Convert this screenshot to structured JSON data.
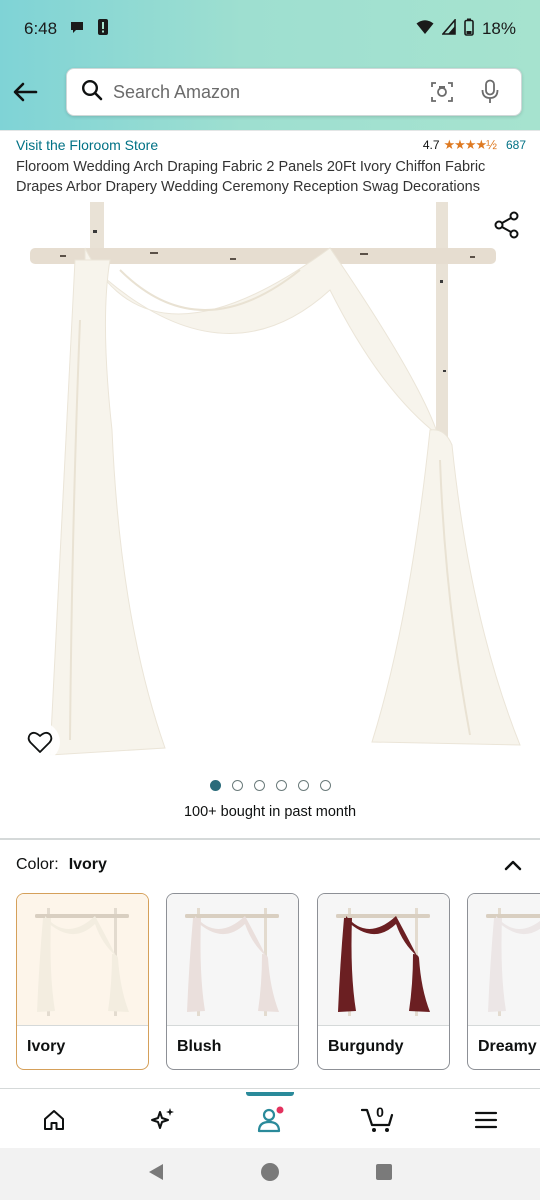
{
  "status": {
    "time": "6:48",
    "battery": "18%"
  },
  "search": {
    "placeholder": "Search Amazon"
  },
  "product": {
    "store_link": "Visit the Floroom Store",
    "rating_value": "4.7",
    "rating_stars": "★★★★½",
    "review_count": "687",
    "title": "Floroom Wedding Arch Draping Fabric 2 Panels 20Ft Ivory Chiffon Fabric Drapes Arbor Drapery Wedding Ceremony Reception Swag Decorations",
    "image_count": 6,
    "active_image": 0,
    "bought_text": "100+ bought in past month"
  },
  "color_section": {
    "label": "Color:",
    "selected": "Ivory",
    "options": [
      {
        "name": "Ivory",
        "fabric": "#f3ede0"
      },
      {
        "name": "Blush",
        "fabric": "#eadfdc"
      },
      {
        "name": "Burgundy",
        "fabric": "#6b1f22"
      },
      {
        "name": "Dreamy",
        "fabric": "#ece6e6"
      }
    ]
  },
  "bottom_nav": {
    "cart_count": "0",
    "active_tab": "account"
  },
  "colors": {
    "accent_teal": "#2a8a9a",
    "link": "#007185",
    "star": "#de7921"
  }
}
